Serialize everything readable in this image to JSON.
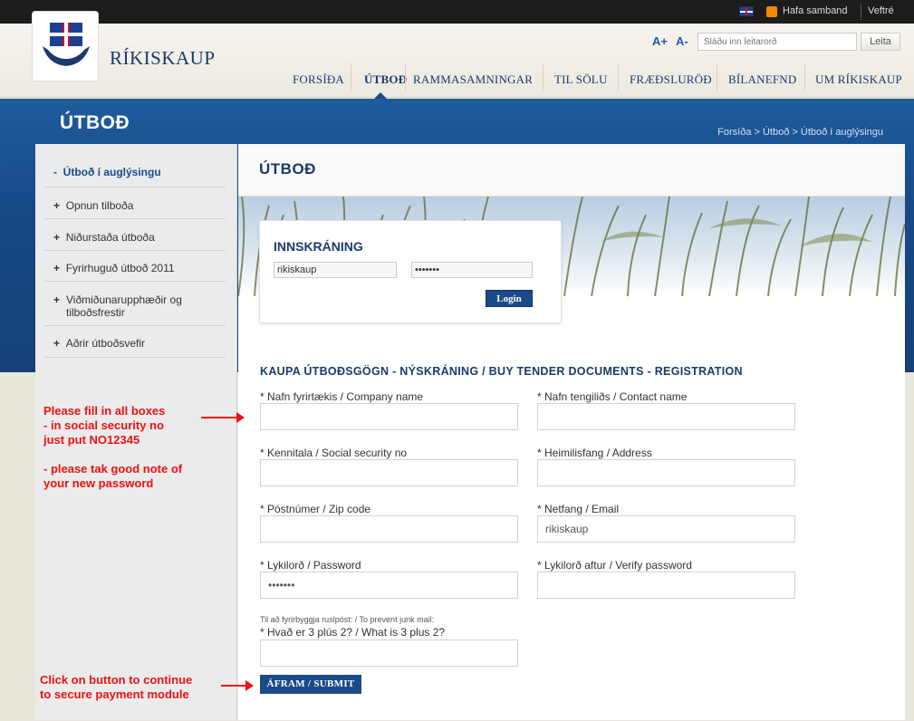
{
  "topbar": {
    "contact": "Hafa samband",
    "webmail": "Veftré",
    "icons": [
      "uk-flag-icon",
      "rss-icon"
    ]
  },
  "header": {
    "brand": "RÍKISKAUP",
    "font_increase": "A+",
    "font_decrease": "A-",
    "search_placeholder": "Sláðu inn leitarorð",
    "search_button": "Leita"
  },
  "nav": [
    {
      "label": "FORSÍÐA",
      "active": false
    },
    {
      "label": "ÚTBOÐ",
      "active": true
    },
    {
      "label": "RAMMASAMNINGAR",
      "active": false
    },
    {
      "label": "TIL SÖLU",
      "active": false
    },
    {
      "label": "FRÆÐSLURÖÐ",
      "active": false
    },
    {
      "label": "BÍLANEFND",
      "active": false
    },
    {
      "label": "UM RÍKISKAUP",
      "active": false
    }
  ],
  "page": {
    "title": "ÚTBOÐ",
    "breadcrumb": "Forsíða > Útboð > Útboð í auglýsingu",
    "content_title": "ÚTBOÐ"
  },
  "sidebar": [
    {
      "label": "Útboð í auglýsingu",
      "prefix": "-",
      "active": true
    },
    {
      "label": "Opnun tilboða",
      "prefix": "+",
      "active": false
    },
    {
      "label": "Niðurstaða útboða",
      "prefix": "+",
      "active": false
    },
    {
      "label": "Fyrirhuguð útboð 2011",
      "prefix": "+",
      "active": false
    },
    {
      "label": "Viðmiðunarupphæðir og tilboðsfrestir",
      "prefix": "+",
      "active": false
    },
    {
      "label": "Aðrir útboðsvefir",
      "prefix": "+",
      "active": false
    }
  ],
  "login": {
    "title": "INNSKRÁNING",
    "username": "rikiskaup",
    "password": "•••••••",
    "button": "Login"
  },
  "registration": {
    "title": "KAUPA ÚTBOÐSGÖGN - NÝSKRÁNING / BUY TENDER DOCUMENTS - REGISTRATION",
    "company_label": "* Nafn fyrirtækis / Company name",
    "company_value": "",
    "contact_label": "* Nafn tengiliðs / Contact name",
    "contact_value": "",
    "ssn_label": "* Kennitala / Social security no",
    "ssn_value": "",
    "address_label": "* Heimilisfang / Address",
    "address_value": "",
    "zip_label": "* Póstnúmer / Zip code",
    "zip_value": "",
    "email_label": "* Netfang / Email",
    "email_value": "rikiskaup",
    "password_label": "* Lykilorð / Password",
    "password_value": "•••••••",
    "verify_label": "* Lykilorð aftur / Verify password",
    "verify_value": "",
    "junk_note": "Til að fyrirbyggja ruslpóst: / To prevent junk mail:",
    "captcha_label": "* Hvað er 3 plús 2? / What is 3 plus 2?",
    "captcha_value": "",
    "submit": "ÁFRAM / SUBMIT"
  },
  "annotations": {
    "note1_line1": "Please fill in all boxes",
    "note1_line2": "- in social security no",
    "note1_line3": "just put NO12345",
    "note1_line4": "- please tak good note of",
    "note1_line5": "your new password",
    "note2_line1": "Click on button to continue",
    "note2_line2": "to secure payment module",
    "color": "#ee1111"
  }
}
